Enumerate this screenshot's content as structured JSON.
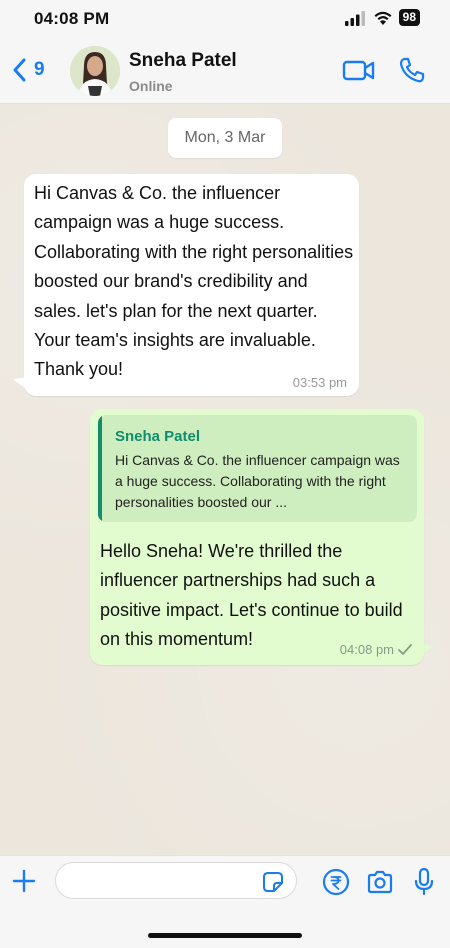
{
  "status_bar": {
    "time": "04:08 PM",
    "battery": "98"
  },
  "header": {
    "back_count": "9",
    "contact_name": "Sneha Patel",
    "contact_status": "Online"
  },
  "chat": {
    "date_label": "Mon, 3 Mar",
    "messages": [
      {
        "direction": "incoming",
        "text": " Hi Canvas & Co. the influencer campaign was a huge success. Collaborating with the right personalities boosted our brand's credibility and sales. let's plan for the next quarter. Your team's insights are invaluable. Thank you!",
        "time": "03:53 pm"
      },
      {
        "direction": "outgoing",
        "quote": {
          "name": "Sneha Patel",
          "text": "Hi Canvas & Co. the influencer campaign was a huge success. Collaborating with the right personalities boosted our ..."
        },
        "text": " Hello Sneha! We're thrilled the influencer partnerships had such a positive impact. Let's continue to build on this momentum!",
        "time": "04:08 pm"
      }
    ]
  },
  "composer": {
    "placeholder": ""
  },
  "colors": {
    "accent": "#1a7cf2",
    "outgoing_bubble": "#e2fccf",
    "quote_bg": "#cfeec0",
    "quote_name": "#128c6b"
  }
}
